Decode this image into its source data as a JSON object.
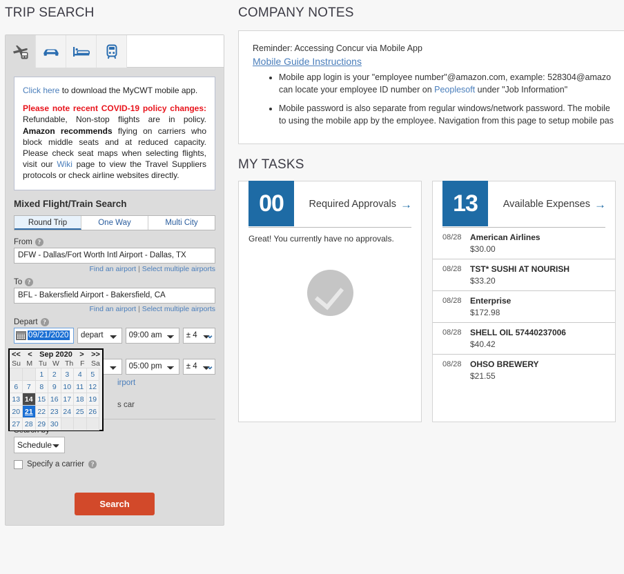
{
  "left": {
    "title": "TRIP SEARCH",
    "tabs": [
      {
        "icon": "plane-train-icon",
        "label": "Mixed Flight/Train",
        "active": true
      },
      {
        "icon": "car-icon",
        "label": "Car",
        "active": false
      },
      {
        "icon": "hotel-bed-icon",
        "label": "Hotel",
        "active": false
      },
      {
        "icon": "train-icon",
        "label": "Rail",
        "active": false
      }
    ],
    "notice": {
      "line1_link": "Click here",
      "line1_rest": " to download the MyCWT mobile app.",
      "headline": "Please note recent COVID-19 policy changes:",
      "body_1": " Refundable, Non-stop flights are in policy. ",
      "bold_1": "Amazon recommends",
      "body_2": " flying on carriers who block middle seats and at reduced capacity. Please check seat maps when selecting flights, visit our ",
      "wiki_link": "Wiki",
      "body_3": " page to view the Travel Suppliers protocols or check airline websites directly."
    },
    "form": {
      "heading": "Mixed Flight/Train Search",
      "trip_types": [
        "Round Trip",
        "One Way",
        "Multi City"
      ],
      "trip_type_selected": "Round Trip",
      "from_label": "From",
      "from_value": "DFW - Dallas/Fort Worth Intl Airport - Dallas, TX",
      "to_label": "To",
      "to_value": "BFL - Bakersfield Airport - Bakersfield, CA",
      "find_airport": "Find an airport",
      "sub_sep": "|",
      "select_multiple": "Select multiple airports",
      "depart_label": "Depart",
      "depart_date": "09/21/2020",
      "depart_mode": "depart",
      "depart_time": "09:00 am",
      "depart_window": "± 4",
      "return_time": "05:00 pm",
      "return_window": "± 4",
      "hidden_text_1": "irport",
      "hidden_text_2": "s car",
      "search_by_label": "Search by",
      "search_by_value": "Schedule",
      "specify_carrier": "Specify a carrier",
      "search_button": "Search"
    },
    "calendar": {
      "prev_year": "<<",
      "prev_month": "<",
      "title": "Sep 2020",
      "next_month": ">",
      "next_year": ">>",
      "dow": [
        "Su",
        "M",
        "Tu",
        "W",
        "Th",
        "F",
        "Sa"
      ],
      "leading_blanks": 2,
      "days": [
        1,
        2,
        3,
        4,
        5,
        6,
        7,
        8,
        9,
        10,
        11,
        12,
        13,
        14,
        15,
        16,
        17,
        18,
        19,
        20,
        21,
        22,
        23,
        24,
        25,
        26,
        27,
        28,
        29,
        30
      ],
      "today": 14,
      "selected": 21
    }
  },
  "right": {
    "notes_title": "COMPANY NOTES",
    "notes": {
      "reminder": "Reminder: Accessing Concur via Mobile App",
      "guide_link": "Mobile Guide Instructions",
      "bullets": [
        {
          "line1": "Mobile app login is your \"employee number\"@amazon.com, example: 528304@amazo",
          "line2_pre": "can locate your employee ID number on ",
          "line2_link": "Peoplesoft",
          "line2_post": " under \"Job Information\""
        },
        {
          "line1": "Mobile password is also separate from regular windows/network password. The mobile",
          "line2_pre": "to using the mobile app by the employee. Navigation from this page to setup mobile pas",
          "line2_link": "",
          "line2_post": ""
        }
      ]
    },
    "tasks_title": "MY TASKS",
    "cards": [
      {
        "count": "00",
        "title": "Required Approvals",
        "arrow": "→",
        "empty_message": "Great! You currently have no approvals.",
        "icon": "check-circle-icon",
        "items": []
      },
      {
        "count": "13",
        "title": "Available Expenses",
        "arrow": "→",
        "empty_message": "",
        "items": [
          {
            "date": "08/28",
            "name": "American Airlines",
            "amount": "$30.00"
          },
          {
            "date": "08/28",
            "name": "TST* SUSHI AT NOURISH",
            "amount": "$33.20"
          },
          {
            "date": "08/28",
            "name": "Enterprise",
            "amount": "$172.98"
          },
          {
            "date": "08/28",
            "name": "SHELL OIL 57440237006",
            "amount": "$40.42"
          },
          {
            "date": "08/28",
            "name": "OHSO BREWERY",
            "amount": "$21.55"
          }
        ]
      }
    ]
  },
  "colors": {
    "accent_blue": "#1e6ba5",
    "link_blue": "#4a7ebb",
    "alert_red": "#e8141c",
    "button_orange": "#d2492a",
    "panel_gray": "#dcdcdc",
    "page_bg": "#f7f7f7"
  }
}
